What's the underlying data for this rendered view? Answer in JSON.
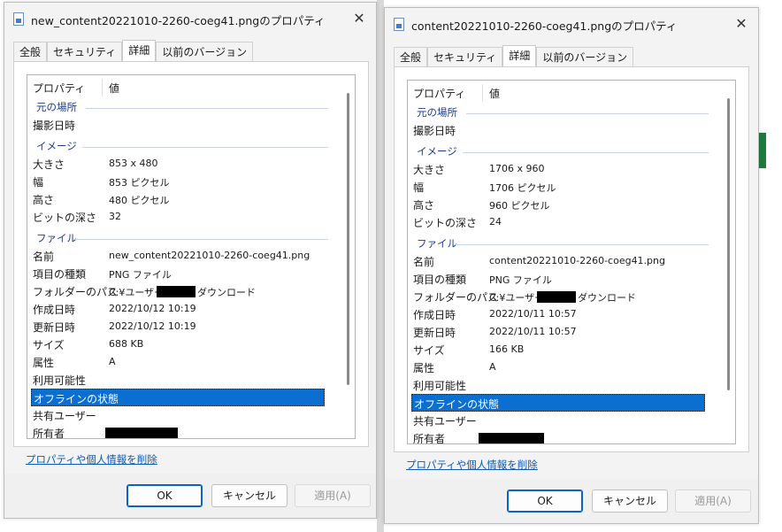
{
  "dialog1": {
    "title": "new_content20221010-2260-coeg41.pngのプロパティ",
    "tabs": [
      "全般",
      "セキュリティ",
      "詳細",
      "以前のバージョン"
    ],
    "active_tab": 2,
    "header": {
      "property": "プロパティ",
      "value": "値"
    },
    "groups": {
      "origin": "元の場所",
      "image": "イメージ",
      "file": "ファイル"
    },
    "rows": {
      "date_taken": "撮影日時",
      "size_dim_label": "大きさ",
      "size_dim_value": "853 x 480",
      "width_label": "幅",
      "width_value": "853 ピクセル",
      "height_label": "高さ",
      "height_value": "480 ピクセル",
      "bitdepth_label": "ビットの深さ",
      "bitdepth_value": "32",
      "name_label": "名前",
      "name_value": "new_content20221010-2260-coeg41.png",
      "type_label": "項目の種類",
      "type_value": "PNG ファイル",
      "folder_label": "フォルダーのパス",
      "folder_value_a": "C:¥ユーザー",
      "folder_value_b": "ダウンロード",
      "created_label": "作成日時",
      "created_value": "2022/10/12 10:19",
      "modified_label": "更新日時",
      "modified_value": "2022/10/12 10:19",
      "filesize_label": "サイズ",
      "filesize_value": "688 KB",
      "attr_label": "属性",
      "attr_value": "A",
      "availability_label": "利用可能性",
      "offline_label": "オフラインの状態",
      "shared_label": "共有ユーザー",
      "owner_label": "所有者"
    },
    "link": "プロパティや個人情報を削除",
    "buttons": {
      "ok": "OK",
      "cancel": "キャンセル",
      "apply": "適用(A)"
    }
  },
  "dialog2": {
    "title": "content20221010-2260-coeg41.pngのプロパティ",
    "tabs": [
      "全般",
      "セキュリティ",
      "詳細",
      "以前のバージョン"
    ],
    "active_tab": 2,
    "header": {
      "property": "プロパティ",
      "value": "値"
    },
    "groups": {
      "origin": "元の場所",
      "image": "イメージ",
      "file": "ファイル"
    },
    "rows": {
      "date_taken": "撮影日時",
      "size_dim_label": "大きさ",
      "size_dim_value": "1706 x 960",
      "width_label": "幅",
      "width_value": "1706 ピクセル",
      "height_label": "高さ",
      "height_value": "960 ピクセル",
      "bitdepth_label": "ビットの深さ",
      "bitdepth_value": "24",
      "name_label": "名前",
      "name_value": "content20221010-2260-coeg41.png",
      "type_label": "項目の種類",
      "type_value": "PNG ファイル",
      "folder_label": "フォルダーのパス",
      "folder_value_a": "C:¥ユーザー",
      "folder_value_b": "ダウンロード",
      "created_label": "作成日時",
      "created_value": "2022/10/11 10:57",
      "modified_label": "更新日時",
      "modified_value": "2022/10/11 10:57",
      "filesize_label": "サイズ",
      "filesize_value": "166 KB",
      "attr_label": "属性",
      "attr_value": "A",
      "availability_label": "利用可能性",
      "offline_label": "オフラインの状態",
      "shared_label": "共有ユーザー",
      "owner_label": "所有者"
    },
    "link": "プロパティや個人情報を削除",
    "buttons": {
      "ok": "OK",
      "cancel": "キャンセル",
      "apply": "適用(A)"
    }
  },
  "colors": {
    "selection": "#0a6fd0",
    "link": "#0a5bb5",
    "group_heading": "#1e3a8a",
    "ok_border": "#0a64c8"
  },
  "icons": {
    "file": "png-file-icon",
    "close": "close-icon"
  }
}
